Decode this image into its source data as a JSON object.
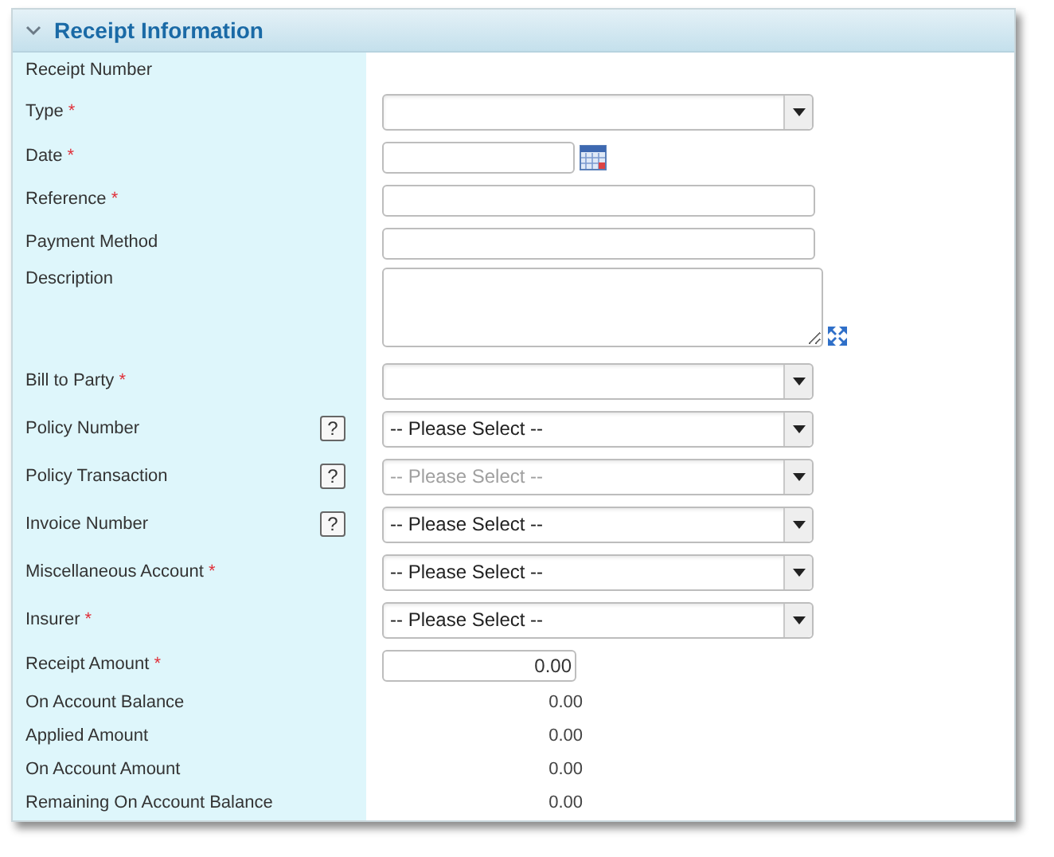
{
  "section": {
    "title": "Receipt Information",
    "expanded": true
  },
  "fields": [
    {
      "label": "Receipt Number",
      "kind": "none"
    },
    {
      "label": "Type",
      "required_mark": "*",
      "kind": "select"
    },
    {
      "label": "Date",
      "required_mark": "*",
      "kind": "date"
    },
    {
      "label": "Reference",
      "required_mark": "*",
      "kind": "text"
    },
    {
      "label": "Payment Method",
      "kind": "text"
    },
    {
      "label": "Description",
      "kind": "textarea"
    },
    {
      "label": "Bill to Party",
      "required_mark": "*",
      "kind": "select"
    },
    {
      "label": "Policy Number",
      "help": "?",
      "kind": "select",
      "value": "-- Please Select --",
      "disabled": false
    },
    {
      "label": "Policy Transaction",
      "help": "?",
      "kind": "select",
      "value": "-- Please Select --",
      "disabled": true
    },
    {
      "label": "Invoice Number",
      "help": "?",
      "kind": "select",
      "value": "-- Please Select --",
      "disabled": false
    },
    {
      "label": "Miscellaneous Account",
      "required_mark": "*",
      "kind": "select",
      "value": "-- Please Select --",
      "disabled": false
    },
    {
      "label": "Insurer",
      "required_mark": "*",
      "kind": "select",
      "value": "-- Please Select --",
      "disabled": false
    },
    {
      "label": "Receipt Amount",
      "required_mark": "*",
      "kind": "amount",
      "value": "0.00"
    },
    {
      "label": "On Account Balance",
      "kind": "value",
      "value": "0.00"
    },
    {
      "label": "Applied Amount",
      "kind": "value",
      "value": "0.00"
    },
    {
      "label": "On Account Amount",
      "kind": "value",
      "value": "0.00"
    },
    {
      "label": "Remaining On Account Balance",
      "kind": "value",
      "value": "0.00"
    }
  ]
}
